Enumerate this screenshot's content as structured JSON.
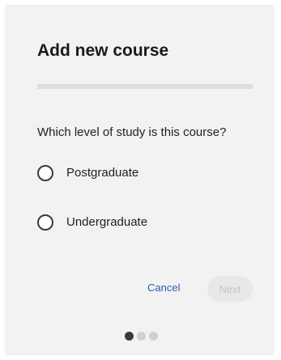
{
  "dialog": {
    "title": "Add new course",
    "progress_fraction": 0,
    "question": "Which level of study is this course?",
    "options": [
      {
        "label": "Postgraduate",
        "selected": false
      },
      {
        "label": "Undergraduate",
        "selected": false
      }
    ],
    "cancel_label": "Cancel",
    "next_label": "Next",
    "next_enabled": false,
    "steps": {
      "total": 3,
      "current": 1
    }
  },
  "colors": {
    "background": "#f2f2f2",
    "link": "#2a5fb0",
    "disabled_text": "#c4c4c4",
    "active_dot": "#3a3a3a",
    "inactive_dot": "#d0d0d0"
  }
}
